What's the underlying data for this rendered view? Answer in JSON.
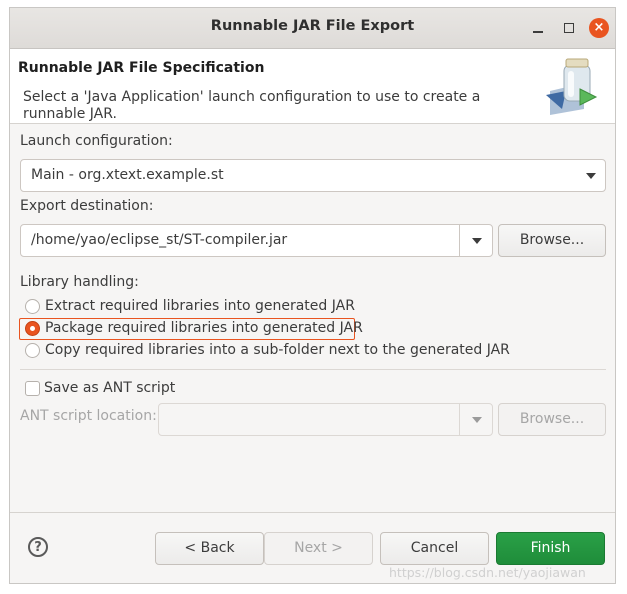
{
  "window": {
    "title": "Runnable JAR File Export",
    "close_glyph": "×"
  },
  "header": {
    "title": "Runnable JAR File Specification",
    "description": "Select a 'Java Application' launch configuration to use to create a runnable JAR.",
    "icon": "jar-export-wizard-icon"
  },
  "launch": {
    "label": "Launch configuration:",
    "value": "Main - org.xtext.example.st"
  },
  "export": {
    "label": "Export destination:",
    "value": "/home/yao/eclipse_st/ST-compiler.jar",
    "browse": "Browse..."
  },
  "library": {
    "label": "Library handling:",
    "options": [
      {
        "label": "Extract required libraries into generated JAR",
        "checked": false
      },
      {
        "label": "Package required libraries into generated JAR",
        "checked": true
      },
      {
        "label": "Copy required libraries into a sub-folder next to the generated JAR",
        "checked": false
      }
    ]
  },
  "ant": {
    "save_label": "Save as ANT script",
    "location_label": "ANT script location:",
    "value": "",
    "browse": "Browse..."
  },
  "footer": {
    "help": "?",
    "back": "< Back",
    "next": "Next >",
    "cancel": "Cancel",
    "finish": "Finish"
  },
  "colors": {
    "accent": "#e95420",
    "finish": "#26a044",
    "disabled_text": "#a6a6a6"
  },
  "watermark": "https://blog.csdn.net/yaojiawan"
}
